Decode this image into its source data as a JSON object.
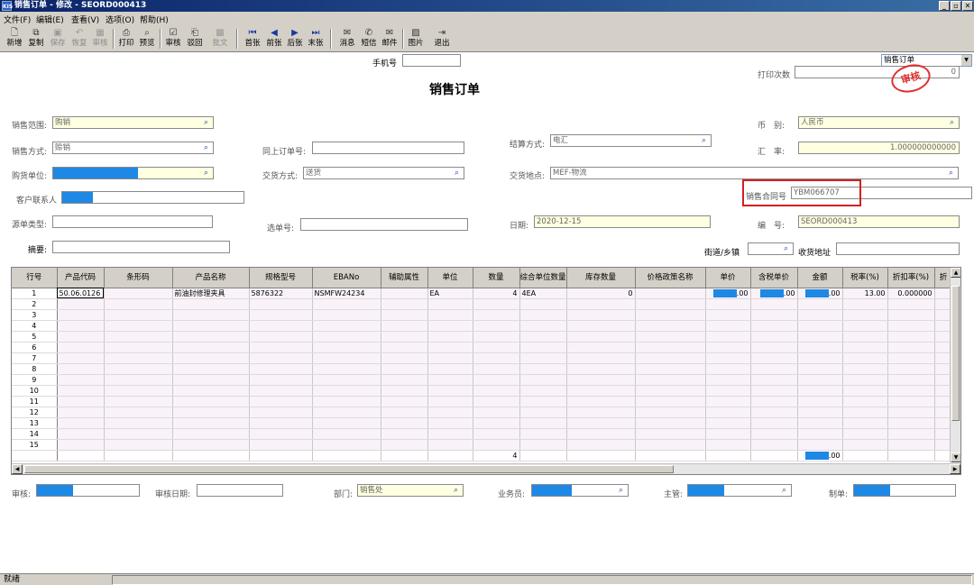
{
  "window": {
    "title": "销售订单 - 修改 - SEORD000413",
    "logo": "KIS",
    "controls": [
      "_",
      "▫",
      "✕"
    ]
  },
  "menu": [
    "文件(F)",
    "编辑(E)",
    "查看(V)",
    "选项(O)",
    "帮助(H)"
  ],
  "toolbar": [
    {
      "label": "新增",
      "icon": "new-icon",
      "glyph": "🗋",
      "enabled": true
    },
    {
      "label": "复制",
      "icon": "copy-icon",
      "glyph": "⧉",
      "enabled": true
    },
    {
      "label": "保存",
      "icon": "save-icon",
      "glyph": "▣",
      "enabled": false
    },
    {
      "label": "恢复",
      "icon": "undo-icon",
      "glyph": "↶",
      "enabled": false
    },
    {
      "label": "审核",
      "icon": "audit-icon",
      "glyph": "▦",
      "enabled": false
    },
    {
      "label": "打印",
      "icon": "print-icon",
      "glyph": "⎙",
      "enabled": true
    },
    {
      "label": "预览",
      "icon": "preview-icon",
      "glyph": "⌕",
      "enabled": true
    },
    {
      "label": "审核",
      "icon": "approve-icon",
      "glyph": "☑",
      "enabled": true
    },
    {
      "label": "驳回",
      "icon": "reject-icon",
      "glyph": "⎗",
      "enabled": true
    },
    {
      "label": "批文",
      "icon": "batch-icon",
      "glyph": "▩",
      "enabled": false
    },
    {
      "label": "首张",
      "icon": "first-icon",
      "glyph": "⏮",
      "enabled": true,
      "nav": true
    },
    {
      "label": "前张",
      "icon": "prev-icon",
      "glyph": "◀",
      "enabled": true,
      "nav": true
    },
    {
      "label": "后张",
      "icon": "next-icon",
      "glyph": "▶",
      "enabled": true,
      "nav": true
    },
    {
      "label": "末张",
      "icon": "last-icon",
      "glyph": "⏭",
      "enabled": true,
      "nav": true
    },
    {
      "label": "消息",
      "icon": "message-icon",
      "glyph": "✉",
      "enabled": true
    },
    {
      "label": "短信",
      "icon": "sms-icon",
      "glyph": "✆",
      "enabled": true
    },
    {
      "label": "邮件",
      "icon": "mail-icon",
      "glyph": "✉",
      "enabled": true
    },
    {
      "label": "图片",
      "icon": "picture-icon",
      "glyph": "▨",
      "enabled": true
    },
    {
      "label": "退出",
      "icon": "exit-icon",
      "glyph": "⇥",
      "enabled": true
    }
  ],
  "view_select": "销售订单",
  "form": {
    "title": "销售订单",
    "stamp": "审核",
    "phone_label": "手机号",
    "phone": "",
    "print_count_label": "打印次数",
    "print_count": "0",
    "sales_scope_label": "销售范围:",
    "sales_scope": "购销",
    "sales_method_label": "销售方式:",
    "sales_method": "赊销",
    "buyer_label": "购货单位:",
    "buyer": "",
    "contact_label": "客户联系人",
    "contact": "",
    "source_type_label": "源单类型:",
    "source_type": "",
    "summary_label": "摘要:",
    "summary": "",
    "upstream_order_label": "同上订单号:",
    "upstream_order": "",
    "delivery_method_label": "交货方式:",
    "delivery_method": "送货",
    "select_no_label": "选单号:",
    "select_no": "",
    "settle_method_label": "结算方式:",
    "settle_method": "电汇",
    "delivery_place_label": "交货地点:",
    "delivery_place": "MEF-物流",
    "date_label": "日期:",
    "date": "2020-12-15",
    "currency_label": "币　别:",
    "currency": "人民币",
    "rate_label": "汇　率:",
    "rate": "1.000000000000",
    "contract_label": "销售合同号",
    "contract": "YBM066707",
    "number_label": "编　号:",
    "number": "SEORD000413",
    "street_label": "街道/乡镇",
    "street": "",
    "address_label": "收货地址",
    "address": ""
  },
  "grid": {
    "headers": [
      "行号",
      "产品代码",
      "条形码",
      "产品名称",
      "规格型号",
      "EBANo",
      "辅助属性",
      "单位",
      "数量",
      "综合单位数量",
      "库存数量",
      "价格政策名称",
      "单价",
      "含税单价",
      "金额",
      "税率(%)",
      "折扣率(%)",
      "折"
    ],
    "rows": [
      {
        "no": "1",
        "code": "50.06.0126",
        "barcode": "",
        "name": "前油封修理夹具",
        "spec": "5876322",
        "ebano": "NSMFW24234",
        "aux": "",
        "unit": "EA",
        "qty": "4",
        "combo": "4EA",
        "stock": "0",
        "policy": "",
        "price": ".00",
        "taxprice": ".00",
        "amount": ".00",
        "taxrate": "13.00",
        "discount": "0.000000"
      },
      {
        "no": "2"
      },
      {
        "no": "3"
      },
      {
        "no": "4"
      },
      {
        "no": "5"
      },
      {
        "no": "6"
      },
      {
        "no": "7"
      },
      {
        "no": "8"
      },
      {
        "no": "9"
      },
      {
        "no": "10"
      },
      {
        "no": "11"
      },
      {
        "no": "12"
      },
      {
        "no": "13"
      },
      {
        "no": "14"
      },
      {
        "no": "15"
      }
    ],
    "total_qty": "4",
    "total_amount": ".00"
  },
  "footer": {
    "auditor_label": "审核:",
    "auditor": "",
    "audit_date_label": "审核日期:",
    "audit_date": "",
    "dept_label": "部门:",
    "dept": "销售处",
    "salesman_label": "业务员:",
    "salesman": "",
    "manager_label": "主管:",
    "manager": "",
    "maker_label": "制单:",
    "maker": ""
  },
  "status": "就绪",
  "colors": {
    "highlight": "#1e88e5",
    "stamp": "#e03030",
    "title_bar": "#0a246a"
  }
}
